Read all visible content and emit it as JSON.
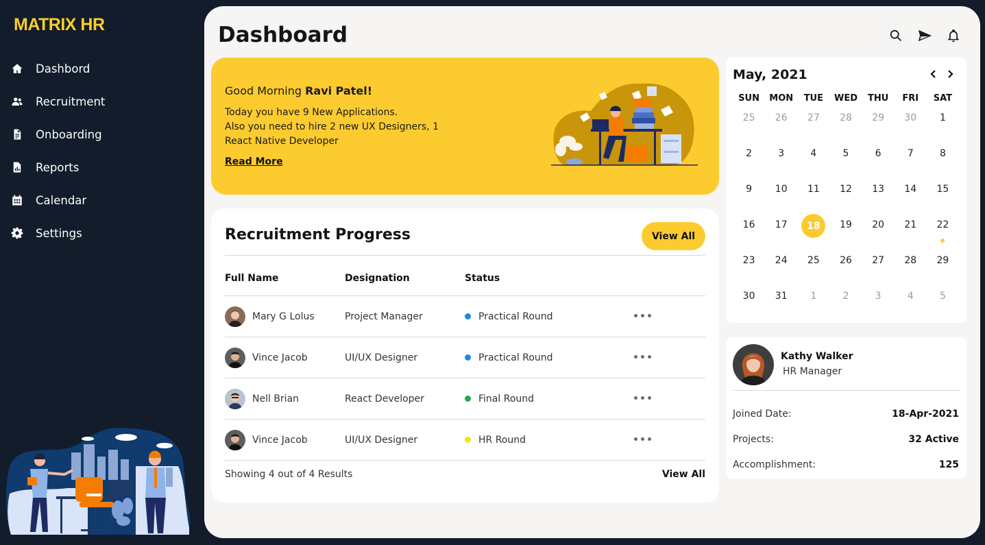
{
  "app": {
    "logo": "MATRIX HR"
  },
  "sidebar": {
    "items": [
      {
        "label": "Dashbord",
        "icon": "home-icon"
      },
      {
        "label": "Recruitment",
        "icon": "users-icon"
      },
      {
        "label": "Onboarding",
        "icon": "document-icon"
      },
      {
        "label": "Reports",
        "icon": "report-icon"
      },
      {
        "label": "Calendar",
        "icon": "calendar-icon"
      },
      {
        "label": "Settings",
        "icon": "gear-icon"
      }
    ]
  },
  "header": {
    "title": "Dashboard",
    "icons": [
      "search-icon",
      "send-icon",
      "bell-icon"
    ]
  },
  "banner": {
    "greeting": "Good Morning ",
    "name": "Ravi Patel!",
    "line1": "Today you have 9 New Applications.",
    "line2": "Also you need to hire 2 new UX Designers, 1 React Native Developer",
    "read_more": "Read More"
  },
  "recruitment": {
    "title": "Recruitment Progress",
    "view_all_button": "View All",
    "columns": [
      "Full Name",
      "Designation",
      "Status"
    ],
    "rows": [
      {
        "name": "Mary G Lolus",
        "designation": "Project Manager",
        "status": "Practical Round",
        "status_color": "#1e88e5"
      },
      {
        "name": "Vince Jacob",
        "designation": "UI/UX Designer",
        "status": "Practical Round",
        "status_color": "#1e88e5"
      },
      {
        "name": "Nell Brian",
        "designation": "React Developer",
        "status": "Final Round",
        "status_color": "#1fae4b"
      },
      {
        "name": "Vince Jacob",
        "designation": "UI/UX Designer",
        "status": "HR Round",
        "status_color": "#f5e312"
      }
    ],
    "footer_text": "Showing 4 out of 4 Results",
    "footer_link": "View All"
  },
  "calendar": {
    "title": "May, 2021",
    "weekdays": [
      "SUN",
      "MON",
      "TUE",
      "WED",
      "THU",
      "FRI",
      "SAT"
    ],
    "weeks": [
      [
        "25",
        "26",
        "27",
        "28",
        "29",
        "30",
        "1"
      ],
      [
        "2",
        "3",
        "4",
        "5",
        "6",
        "7",
        "8"
      ],
      [
        "9",
        "10",
        "11",
        "12",
        "13",
        "14",
        "15"
      ],
      [
        "16",
        "17",
        "18",
        "19",
        "20",
        "21",
        "22"
      ],
      [
        "23",
        "24",
        "25",
        "26",
        "27",
        "28",
        "29"
      ],
      [
        "30",
        "31",
        "1",
        "2",
        "3",
        "4",
        "5"
      ]
    ],
    "muted_leading": 6,
    "muted_trailing": 5,
    "selected_day": "18",
    "event_day": "22"
  },
  "profile": {
    "name": "Kathy Walker",
    "role": "HR Manager",
    "fields": [
      {
        "label": "Joined Date:",
        "value": "18-Apr-2021"
      },
      {
        "label": "Projects:",
        "value": "32 Active"
      },
      {
        "label": "Accomplishment:",
        "value": "125"
      }
    ]
  },
  "colors": {
    "accent": "#fccb2f",
    "sidebar_bg": "#121c2a",
    "logo": "#fccd2d",
    "panel_bg": "#f6f5f3"
  }
}
